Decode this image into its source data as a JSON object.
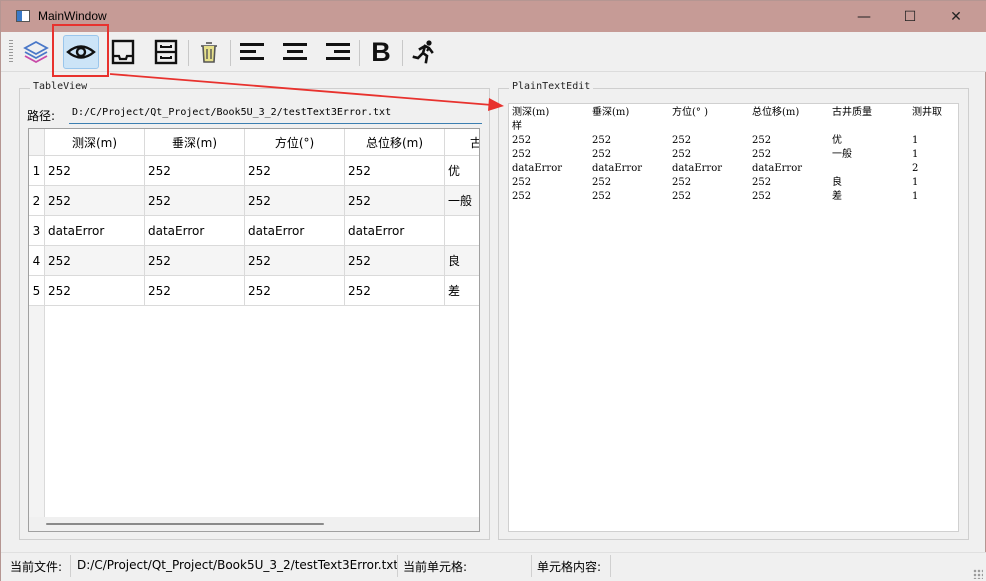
{
  "window": {
    "title": "MainWindow",
    "controls": {
      "minimize": "—",
      "maximize": "☐",
      "close": "✕"
    }
  },
  "toolbar": {
    "buttons": [
      {
        "name": "layers-icon",
        "active": false
      },
      {
        "name": "eye-icon",
        "active": true
      },
      {
        "name": "tray-icon",
        "active": false
      },
      {
        "name": "archive-icon",
        "active": false
      },
      {
        "name": "trash-icon",
        "active": false
      },
      {
        "name": "align-left-icon",
        "active": false
      },
      {
        "name": "align-center-icon",
        "active": false
      },
      {
        "name": "align-right-icon",
        "active": false
      },
      {
        "name": "bold-icon",
        "active": false
      },
      {
        "name": "run-icon",
        "active": false
      }
    ],
    "bold_label": "B"
  },
  "table_group": {
    "title": "TableView",
    "path_label": "路径:",
    "path_value": "D:/C/Project/Qt_Project/Book5U_3_2/testText3Error.txt",
    "headers": [
      "测深(m)",
      "垂深(m)",
      "方位(°)",
      "总位移(m)",
      "古"
    ],
    "row_numbers": [
      "1",
      "2",
      "3",
      "4",
      "5"
    ],
    "rows": [
      [
        "252",
        "252",
        "252",
        "252",
        "优"
      ],
      [
        "252",
        "252",
        "252",
        "252",
        "一般"
      ],
      [
        "dataError",
        "dataError",
        "dataError",
        "dataError",
        ""
      ],
      [
        "252",
        "252",
        "252",
        "252",
        "良"
      ],
      [
        "252",
        "252",
        "252",
        "252",
        "差"
      ]
    ]
  },
  "text_group": {
    "title": "PlainTextEdit",
    "header_cols": [
      "测深(m)",
      "垂深(m)",
      "方位(° )",
      "总位移(m)",
      "古井质量",
      "测井取"
    ],
    "header_wrap": "样",
    "lines": [
      [
        "252",
        "252",
        "252",
        "252",
        "优",
        "1"
      ],
      [
        "252",
        "252",
        "252",
        "252",
        "一般",
        "1"
      ],
      [
        "dataError",
        "dataError",
        "dataError",
        "dataError",
        "",
        "2"
      ],
      [
        "252",
        "252",
        "252",
        "252",
        "良",
        "1"
      ],
      [
        "252",
        "252",
        "252",
        "252",
        "差",
        "1"
      ]
    ]
  },
  "status": {
    "current_file_label": "当前文件:",
    "current_file_value": "D:/C/Project/Qt_Project/Book5U_3_2/testText3Error.txt",
    "current_cell_label": "当前单元格:",
    "cell_content_label": "单元格内容:"
  },
  "colors": {
    "titlebar": "#c69b96",
    "highlight": "#e8322e",
    "active_button": "#cce4f7",
    "arrow": "#e8322e"
  }
}
